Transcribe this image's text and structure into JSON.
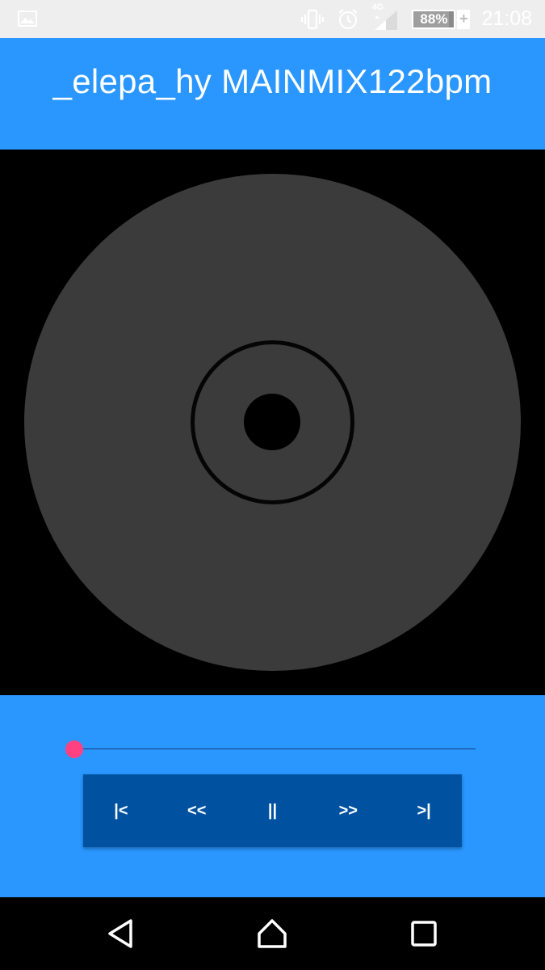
{
  "status_bar": {
    "left_icon": "image-notification-icon",
    "icons": [
      "vibrate-icon",
      "alarm-icon",
      "signal-4g-icon"
    ],
    "network_label": "4G",
    "battery_percent": "88%",
    "battery_level": 0.88,
    "charging_label": "+",
    "time": "21:08"
  },
  "header": {
    "title": "_elepa_hy MAINMIX122bpm"
  },
  "artwork": {
    "icon": "compact-disc-icon"
  },
  "player": {
    "seek_progress": 0.0,
    "accent_color": "#ff4081",
    "controls": {
      "previous": "|<",
      "rewind": "<<",
      "pause": "||",
      "fast_forward": ">>",
      "next": ">|"
    }
  },
  "colors": {
    "primary": "#2997ff",
    "controls_bg": "#0052a0",
    "status_bg": "#eeeeee"
  },
  "nav_bar": {
    "icons": [
      "back-icon",
      "home-icon",
      "recents-icon"
    ]
  }
}
